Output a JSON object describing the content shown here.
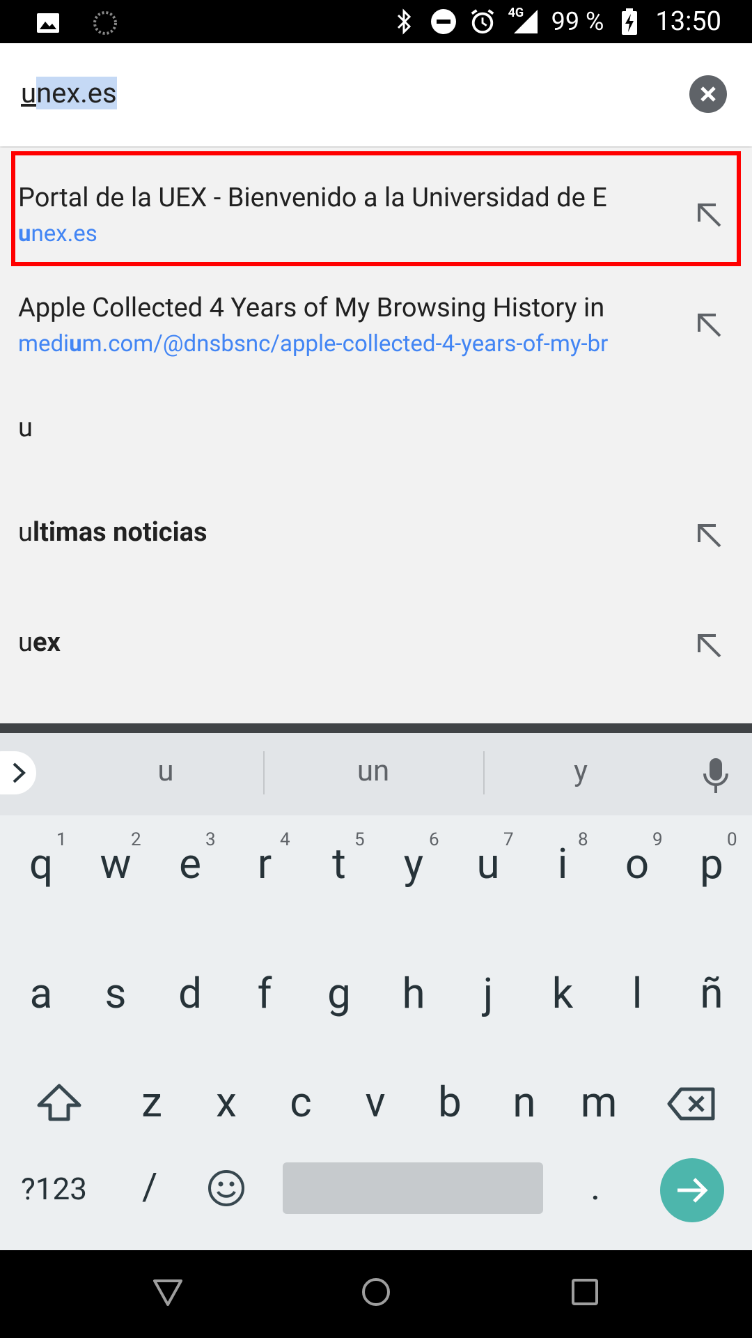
{
  "status_bar": {
    "battery": "99 %",
    "network": "4G",
    "time": "13:50"
  },
  "omnibox": {
    "typed": "u",
    "autocomplete": "nex.es"
  },
  "suggestions": [
    {
      "title": "Portal de la UEX - Bienvenido a la Universidad de E",
      "url_match": "u",
      "url_rest": "nex.es"
    },
    {
      "title": "Apple Collected 4 Years of My Browsing History in",
      "url_pre": "medi",
      "url_match": "u",
      "url_rest": "m.com/@dnsbsnc/apple-collected-4-years-of-my-br"
    },
    {
      "query": "u"
    },
    {
      "query_match": "u",
      "query_rest": "ltimas noticias"
    },
    {
      "query_match": "u",
      "query_rest": "ex"
    }
  ],
  "keyboard": {
    "suggestions": [
      "u",
      "un",
      "y"
    ],
    "row1": [
      {
        "key": "q",
        "num": "1"
      },
      {
        "key": "w",
        "num": "2"
      },
      {
        "key": "e",
        "num": "3"
      },
      {
        "key": "r",
        "num": "4"
      },
      {
        "key": "t",
        "num": "5"
      },
      {
        "key": "y",
        "num": "6"
      },
      {
        "key": "u",
        "num": "7"
      },
      {
        "key": "i",
        "num": "8"
      },
      {
        "key": "o",
        "num": "9"
      },
      {
        "key": "p",
        "num": "0"
      }
    ],
    "row2": [
      "a",
      "s",
      "d",
      "f",
      "g",
      "h",
      "j",
      "k",
      "l",
      "ñ"
    ],
    "row3": [
      "z",
      "x",
      "c",
      "v",
      "b",
      "n",
      "m"
    ],
    "symbols_label": "?123",
    "slash": "/",
    "period": "."
  },
  "colors": {
    "link": "#4285f4",
    "highlight": "#ff0000",
    "go_button": "#4db6ac",
    "selection": "#c5d9f5"
  }
}
